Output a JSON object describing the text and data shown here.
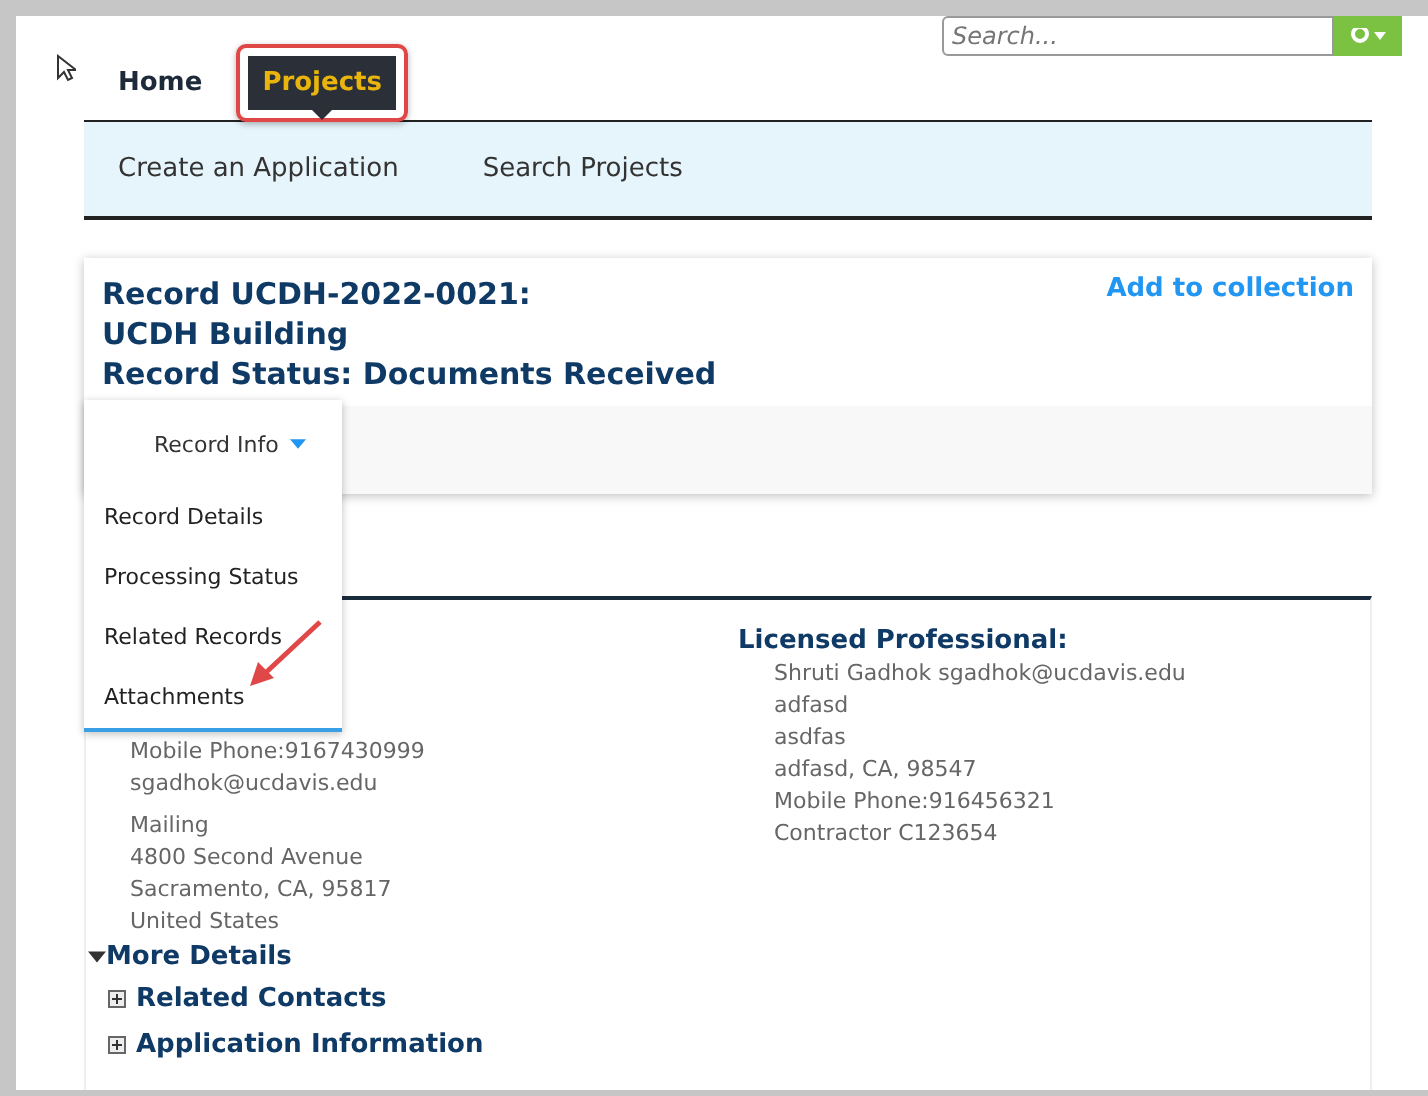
{
  "search": {
    "placeholder": "Search..."
  },
  "nav": [
    {
      "label": "Home",
      "selected": false
    },
    {
      "label": "Projects",
      "selected": true
    }
  ],
  "subnav": [
    "Create an Application",
    "Search Projects"
  ],
  "record": {
    "title_lines": [
      "Record UCDH-2022-0021:",
      "UCDH Building",
      "Record Status: Documents Received"
    ],
    "action": "Add to collection"
  },
  "record_menu": {
    "label": "Record Info",
    "expanded": true,
    "items": [
      "Record Details",
      "Processing Status",
      "Related Records",
      "Attachments"
    ]
  },
  "contact": {
    "lines": [
      "Mobile Phone:9167430999",
      "sgadhok@ucdavis.edu"
    ],
    "address": [
      "Mailing",
      "4800 Second Avenue",
      "Sacramento, CA, 95817",
      "United States"
    ]
  },
  "licensed_professional": {
    "heading": "Licensed Professional:",
    "lines": [
      "Shruti Gadhok sgadhok@ucdavis.edu",
      "adfasd",
      "asdfas",
      "adfasd, CA, 98547",
      "Mobile Phone:916456321",
      "Contractor C123654"
    ]
  },
  "more_details": {
    "label": "More Details",
    "expanded": true,
    "sections": [
      {
        "label": "Related Contacts",
        "expanded": false
      },
      {
        "label": "Application Information",
        "expanded": false
      }
    ]
  }
}
